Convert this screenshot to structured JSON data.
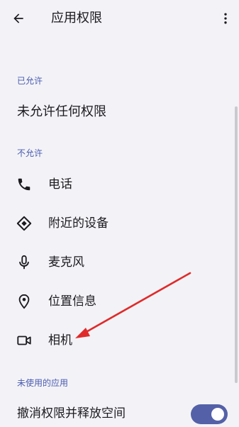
{
  "app_bar": {
    "title": "应用权限",
    "back_icon": "arrow-back-icon",
    "more_icon": "more-vert-icon"
  },
  "sections": {
    "allowed": {
      "header": "已允许",
      "empty_text": "未允许任何权限"
    },
    "not_allowed": {
      "header": "不允许",
      "items": [
        {
          "label": "电话",
          "icon": "phone-icon"
        },
        {
          "label": "附近的设备",
          "icon": "nearby-devices-icon"
        },
        {
          "label": "麦克风",
          "icon": "microphone-icon"
        },
        {
          "label": "位置信息",
          "icon": "location-pin-icon"
        },
        {
          "label": "相机",
          "icon": "videocam-icon"
        }
      ]
    },
    "unused_apps": {
      "header": "未使用的应用",
      "toggle_label": "撤消权限并释放空间",
      "toggle_on": true
    }
  },
  "colors": {
    "background": "#f3f3f7",
    "section_header": "#4a5bb0",
    "toggle_track": "#5461a8",
    "annotation_arrow": "#e02a2a"
  }
}
